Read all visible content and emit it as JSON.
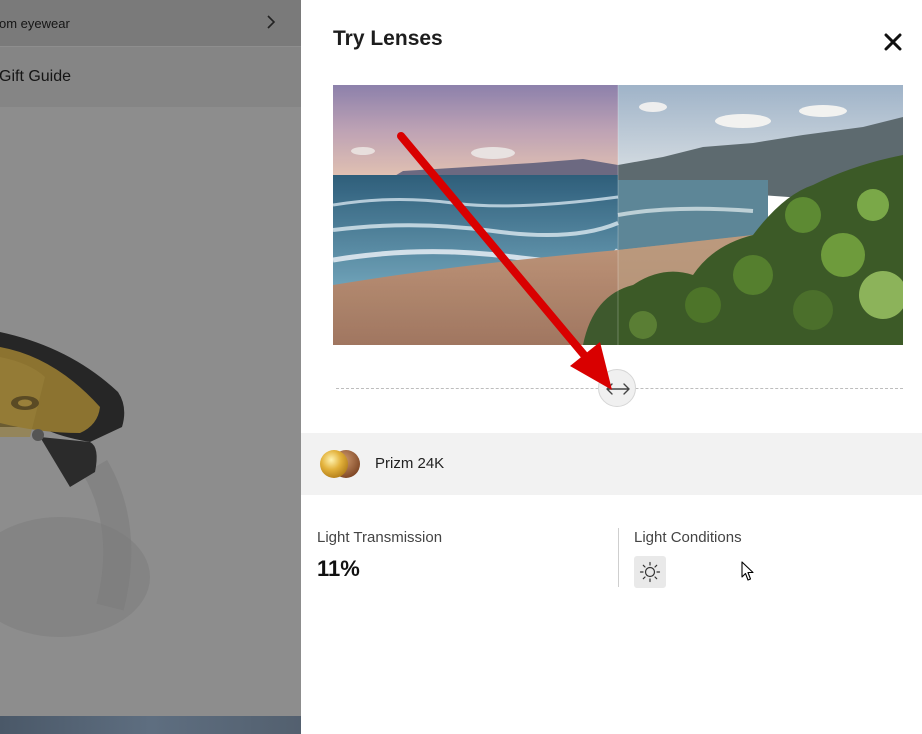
{
  "left_page": {
    "menu_item_1": "om eyewear",
    "menu_item_2": "Gift Guide"
  },
  "drawer": {
    "title": "Try Lenses",
    "lens_name": "Prizm 24K",
    "light_transmission_label": "Light Transmission",
    "light_transmission_value": "11%",
    "light_conditions_label": "Light Conditions",
    "light_condition_icon": "sun-icon"
  },
  "compare_slider": {
    "position": 0.5
  },
  "colors": {
    "overlay_gray": "#8e8e8e",
    "lens_row_bg": "#f2f2f2",
    "annotation_arrow": "#d90000",
    "lens_gold": "#e3b23c",
    "lens_bronze": "#9a5a30"
  }
}
